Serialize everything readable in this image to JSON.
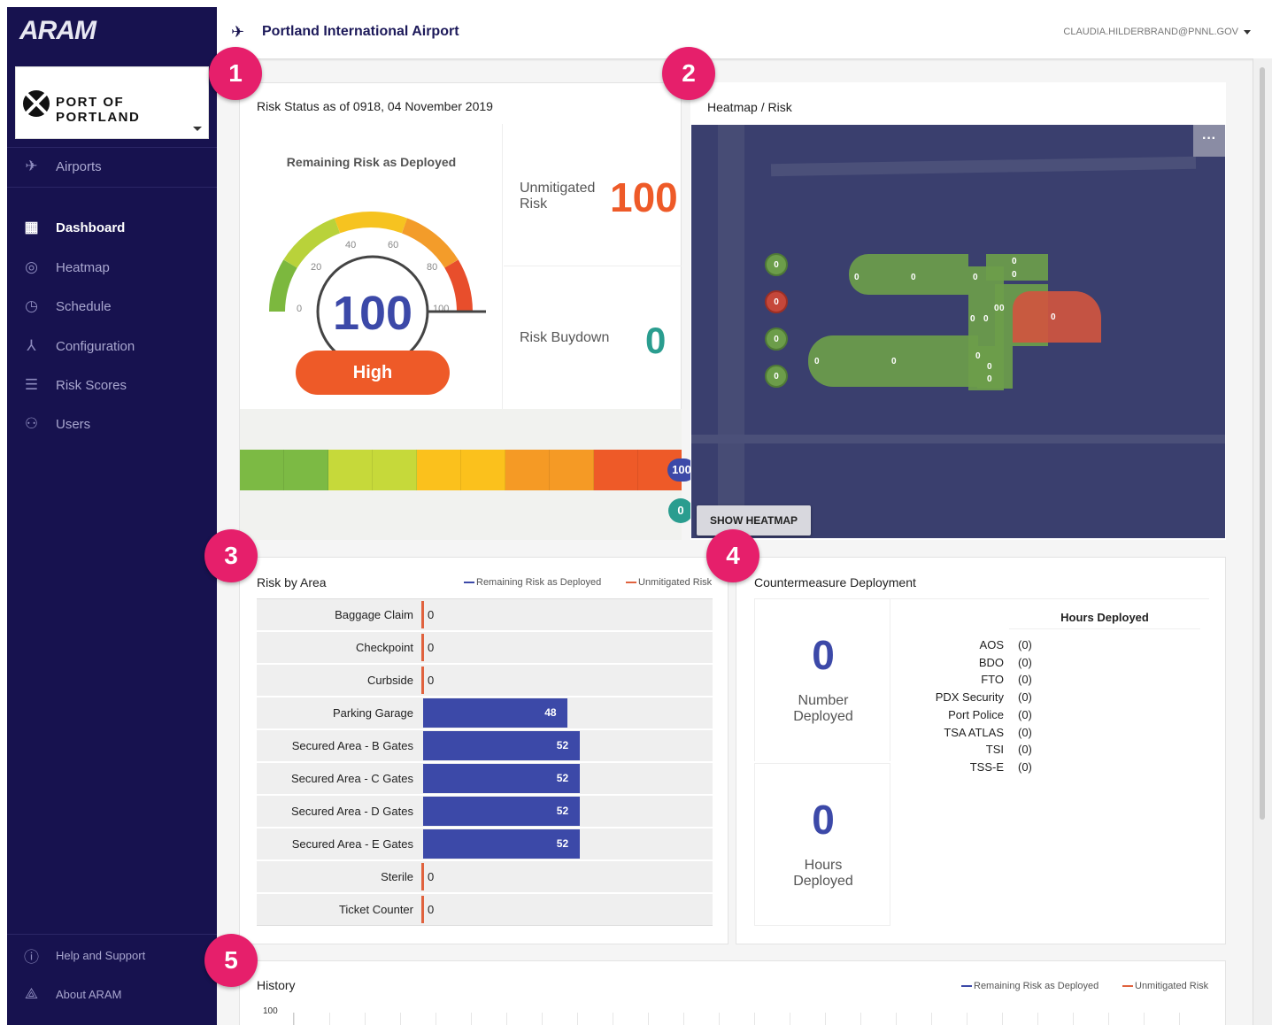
{
  "app": {
    "logo": "ARAM",
    "org_name": "PORT OF PORTLAND"
  },
  "sidebar": {
    "items": [
      {
        "label": "Airports",
        "icon": "plane-icon"
      },
      {
        "label": "Dashboard",
        "icon": "dashboard-icon",
        "active": true
      },
      {
        "label": "Heatmap",
        "icon": "target-icon"
      },
      {
        "label": "Schedule",
        "icon": "clock-icon"
      },
      {
        "label": "Configuration",
        "icon": "network-icon"
      },
      {
        "label": "Risk Scores",
        "icon": "sliders-icon"
      },
      {
        "label": "Users",
        "icon": "users-icon"
      }
    ],
    "footer": [
      {
        "label": "Help and Support",
        "icon": "help-icon"
      },
      {
        "label": "About ARAM",
        "icon": "aram-icon"
      }
    ]
  },
  "header": {
    "title": "Portland International Airport",
    "user": "CLAUDIA.HILDERBRAND@PNNL.GOV"
  },
  "badges": [
    "1",
    "2",
    "3",
    "4",
    "5"
  ],
  "risk_status": {
    "title": "Risk Status as of 0918, 04 November 2019",
    "gauge_title": "Remaining Risk as Deployed",
    "gauge_value": "100",
    "gauge_level": 100,
    "gauge_ticks": [
      "0",
      "20",
      "40",
      "60",
      "80",
      "100"
    ],
    "level_label": "High",
    "unmitigated_label": "Unmitigated Risk",
    "unmitigated_value": "100",
    "buydown_label": "Risk Buydown",
    "buydown_value": "0",
    "scale_marker_top": "100",
    "scale_marker_bottom": "0"
  },
  "heatmap": {
    "title": "Heatmap / Risk",
    "menu_icon": "more-horizontal-icon",
    "button": "SHOW HEATMAP",
    "zone_labels": [
      "0",
      "0",
      "0",
      "0",
      "0",
      "0",
      "0",
      "0",
      "0",
      "0",
      "0",
      "0",
      "0",
      "0",
      "0",
      "0",
      "0",
      "0",
      "0"
    ]
  },
  "risk_by_area": {
    "title": "Risk by Area",
    "legend": [
      {
        "label": "Remaining Risk as Deployed",
        "color": "#3c49a8"
      },
      {
        "label": "Unmitigated Risk",
        "color": "#e0623e"
      }
    ]
  },
  "chart_data": {
    "type": "bar",
    "categories": [
      "Baggage Claim",
      "Checkpoint",
      "Curbside",
      "Parking Garage",
      "Secured Area - B Gates",
      "Secured Area - C Gates",
      "Secured Area - D Gates",
      "Secured Area - E Gates",
      "Sterile",
      "Ticket Counter"
    ],
    "series": [
      {
        "name": "Remaining Risk as Deployed",
        "values": [
          0,
          0,
          0,
          48,
          52,
          52,
          52,
          52,
          0,
          0
        ]
      }
    ],
    "orientation": "horizontal"
  },
  "countermeasure": {
    "title": "Countermeasure Deployment",
    "number_deployed_value": "0",
    "number_deployed_label": "Number Deployed",
    "hours_deployed_value": "0",
    "hours_deployed_label": "Hours Deployed",
    "table_header": "Hours Deployed",
    "rows": [
      {
        "name": "AOS",
        "value": "(0)"
      },
      {
        "name": "BDO",
        "value": "(0)"
      },
      {
        "name": "FTO",
        "value": "(0)"
      },
      {
        "name": "PDX Security",
        "value": "(0)"
      },
      {
        "name": "Port Police",
        "value": "(0)"
      },
      {
        "name": "TSA ATLAS",
        "value": "(0)"
      },
      {
        "name": "TSI",
        "value": "(0)"
      },
      {
        "name": "TSS-E",
        "value": "(0)"
      }
    ]
  },
  "history": {
    "title": "History",
    "legend": [
      {
        "label": "Remaining Risk as Deployed",
        "color": "#3c49a8"
      },
      {
        "label": "Unmitigated Risk",
        "color": "#e0623e"
      }
    ],
    "y_tick_top": "100"
  }
}
